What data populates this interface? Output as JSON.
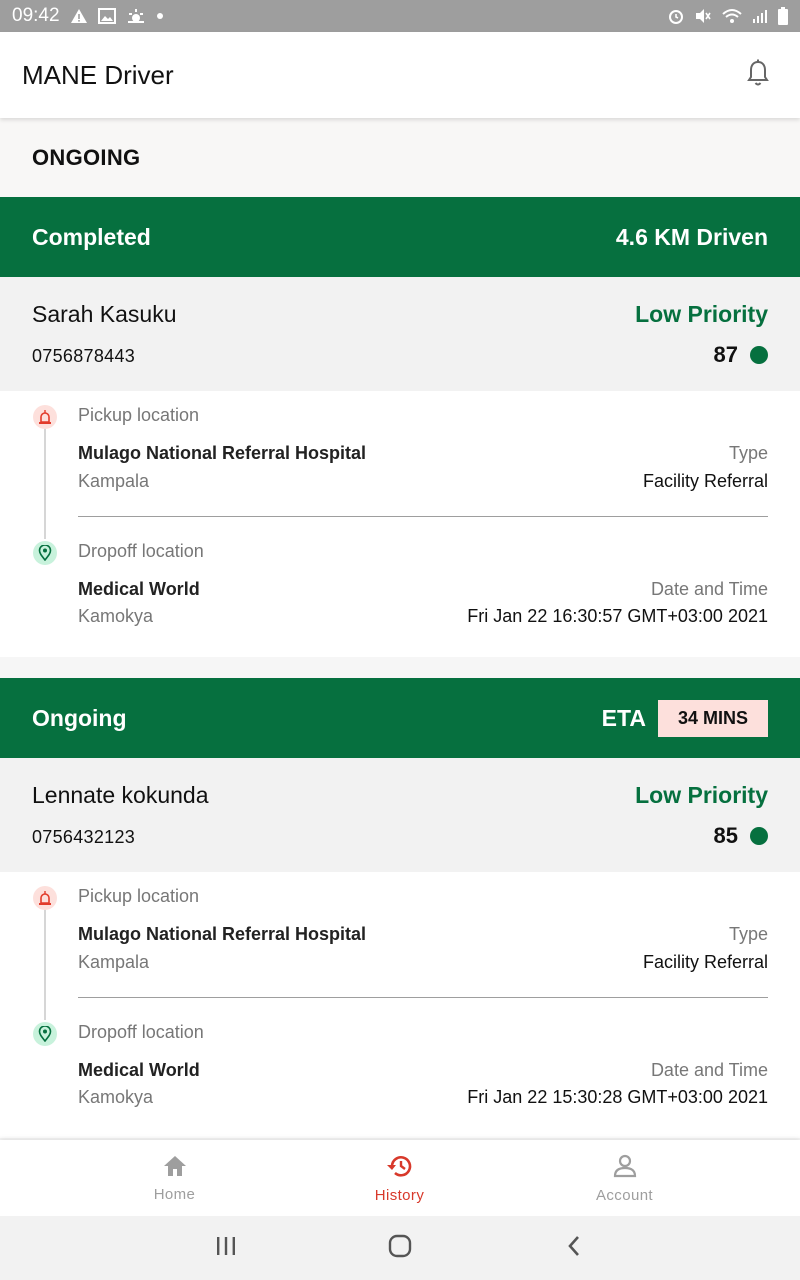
{
  "status_bar": {
    "time": "09:42"
  },
  "app_bar": {
    "title": "MANE Driver"
  },
  "section": {
    "title": "ONGOING"
  },
  "trips": [
    {
      "status": "Completed",
      "metric": "4.6 KM Driven",
      "patient_name": "Sarah Kasuku",
      "phone": "0756878443",
      "priority": "Low Priority",
      "score": "87",
      "pickup_label": "Pickup location",
      "pickup_name": "Mulago National Referral Hospital",
      "pickup_city": "Kampala",
      "type_label": "Type",
      "type_value": "Facility Referral",
      "dropoff_label": "Dropoff location",
      "dropoff_name": "Medical World",
      "dropoff_city": "Kamokya",
      "datetime_label": "Date and Time",
      "datetime_value": "Fri Jan 22 16:30:57 GMT+03:00 2021"
    },
    {
      "status": "Ongoing",
      "eta_label": "ETA",
      "eta_value": "34 MINS",
      "patient_name": "Lennate kokunda",
      "phone": "0756432123",
      "priority": "Low Priority",
      "score": "85",
      "pickup_label": "Pickup location",
      "pickup_name": "Mulago National Referral Hospital",
      "pickup_city": "Kampala",
      "type_label": "Type",
      "type_value": "Facility Referral",
      "dropoff_label": "Dropoff location",
      "dropoff_name": "Medical World",
      "dropoff_city": "Kamokya",
      "datetime_label": "Date and Time",
      "datetime_value": "Fri Jan 22 15:30:28 GMT+03:00 2021"
    }
  ],
  "bottom_nav": [
    {
      "label": "Home",
      "icon": "home-icon",
      "active": false
    },
    {
      "label": "History",
      "icon": "history-icon",
      "active": true
    },
    {
      "label": "Account",
      "icon": "account-icon",
      "active": false
    }
  ],
  "colors": {
    "primary_green": "#06703f",
    "active_red": "#d8392b",
    "eta_badge_bg": "#fde0dc"
  }
}
